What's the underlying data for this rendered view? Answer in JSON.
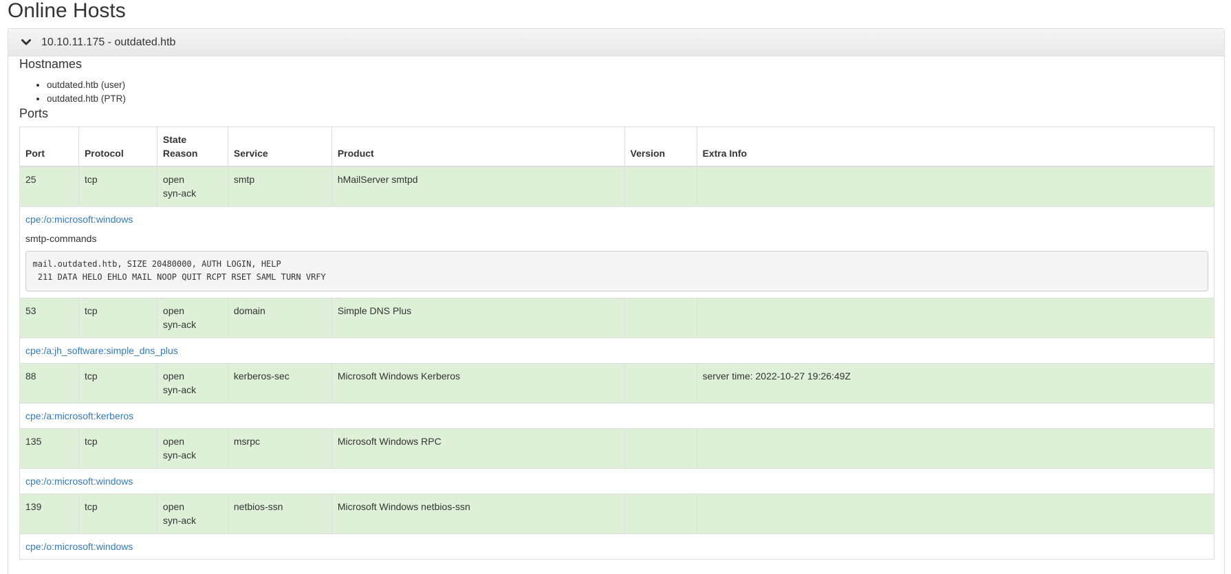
{
  "page_title": "Online Hosts",
  "host": {
    "heading": "10.10.11.175 - outdated.htb",
    "expanded_icon": "chevron-down-icon",
    "hostnames_title": "Hostnames",
    "hostnames": [
      "outdated.htb (user)",
      "outdated.htb (PTR)"
    ],
    "ports_title": "Ports",
    "columns": {
      "port": "Port",
      "protocol": "Protocol",
      "state_1": "State",
      "state_2": "Reason",
      "service": "Service",
      "product": "Product",
      "version": "Version",
      "extra": "Extra Info"
    },
    "ports": [
      {
        "port": "25",
        "protocol": "tcp",
        "state": "open",
        "reason": "syn-ack",
        "service": "smtp",
        "product": "hMailServer smtpd",
        "version": "",
        "extra": "",
        "cpe": "cpe:/o:microsoft:windows",
        "script_name": "smtp-commands",
        "script_output": "mail.outdated.htb, SIZE 20480000, AUTH LOGIN, HELP\n 211 DATA HELO EHLO MAIL NOOP QUIT RCPT RSET SAML TURN VRFY"
      },
      {
        "port": "53",
        "protocol": "tcp",
        "state": "open",
        "reason": "syn-ack",
        "service": "domain",
        "product": "Simple DNS Plus",
        "version": "",
        "extra": "",
        "cpe": "cpe:/a:jh_software:simple_dns_plus"
      },
      {
        "port": "88",
        "protocol": "tcp",
        "state": "open",
        "reason": "syn-ack",
        "service": "kerberos-sec",
        "product": "Microsoft Windows Kerberos",
        "version": "",
        "extra": "server time: 2022-10-27 19:26:49Z",
        "cpe": "cpe:/a:microsoft:kerberos"
      },
      {
        "port": "135",
        "protocol": "tcp",
        "state": "open",
        "reason": "syn-ack",
        "service": "msrpc",
        "product": "Microsoft Windows RPC",
        "version": "",
        "extra": "",
        "cpe": "cpe:/o:microsoft:windows"
      },
      {
        "port": "139",
        "protocol": "tcp",
        "state": "open",
        "reason": "syn-ack",
        "service": "netbios-ssn",
        "product": "Microsoft Windows netbios-ssn",
        "version": "",
        "extra": "",
        "cpe": "cpe:/o:microsoft:windows"
      }
    ]
  }
}
